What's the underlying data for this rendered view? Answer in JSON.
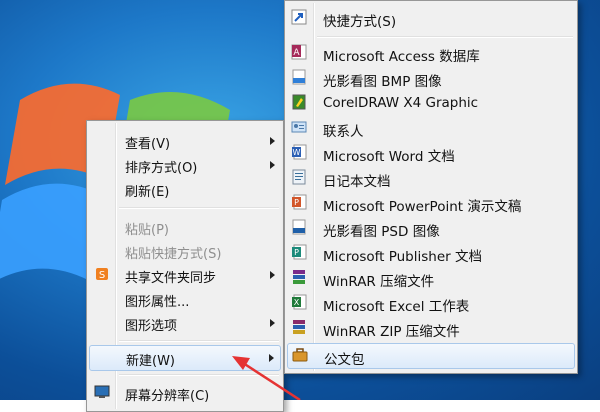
{
  "context_menu": {
    "items": [
      {
        "label": "查看(V)"
      },
      {
        "label": "排序方式(O)"
      },
      {
        "label": "刷新(E)"
      },
      {
        "label": "粘贴(P)"
      },
      {
        "label": "粘贴快捷方式(S)"
      },
      {
        "label": "共享文件夹同步"
      },
      {
        "label": "图形属性..."
      },
      {
        "label": "图形选项"
      },
      {
        "label": "新建(W)"
      },
      {
        "label": "屏幕分辨率(C)"
      }
    ]
  },
  "new_submenu": {
    "items": [
      {
        "label": "快捷方式(S)",
        "icon": "shortcut-icon"
      },
      {
        "label": "Microsoft Access 数据库",
        "icon": "access-icon"
      },
      {
        "label": "光影看图 BMP 图像",
        "icon": "bmp-icon"
      },
      {
        "label": "CorelDRAW X4 Graphic",
        "icon": "coreldraw-icon"
      },
      {
        "label": "联系人",
        "icon": "contact-icon"
      },
      {
        "label": "Microsoft Word 文档",
        "icon": "word-icon"
      },
      {
        "label": "日记本文档",
        "icon": "journal-icon"
      },
      {
        "label": "Microsoft PowerPoint 演示文稿",
        "icon": "powerpoint-icon"
      },
      {
        "label": "光影看图 PSD 图像",
        "icon": "psd-icon"
      },
      {
        "label": "Microsoft Publisher 文档",
        "icon": "publisher-icon"
      },
      {
        "label": "WinRAR 压缩文件",
        "icon": "winrar-icon"
      },
      {
        "label": "Microsoft Excel 工作表",
        "icon": "excel-icon"
      },
      {
        "label": "WinRAR ZIP 压缩文件",
        "icon": "winrar-zip-icon"
      },
      {
        "label": "公文包",
        "icon": "briefcase-icon"
      }
    ]
  },
  "colors": {
    "highlight": "#dceafa",
    "arrow": "#e53333",
    "desktop": "#1d78c8"
  }
}
